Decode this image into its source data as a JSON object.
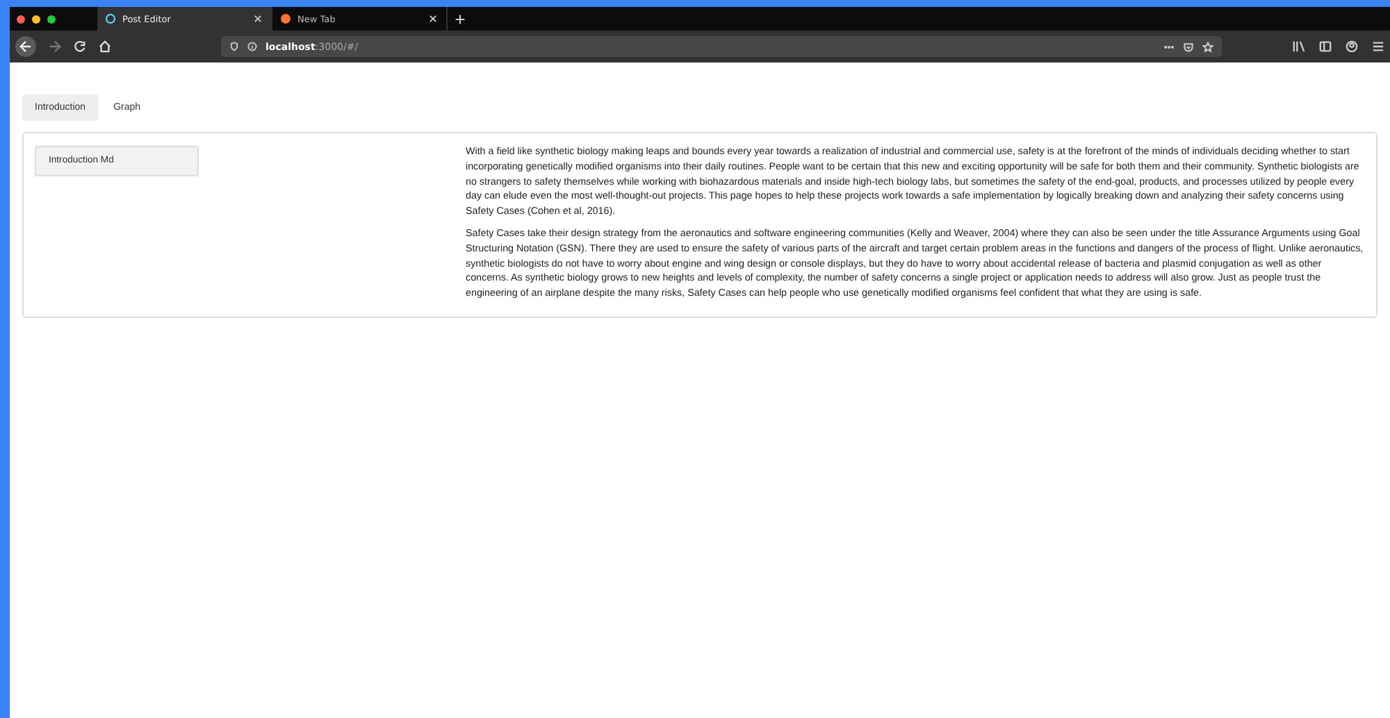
{
  "browser": {
    "tabs": [
      {
        "title": "Post Editor",
        "selected": true
      },
      {
        "title": "New Tab",
        "selected": false
      }
    ],
    "url_host": "localhost",
    "url_rest": ":3000/#/"
  },
  "page_tabs": [
    {
      "label": "Introduction",
      "selected": true
    },
    {
      "label": "Graph",
      "selected": false
    }
  ],
  "sidebar": {
    "items": [
      {
        "label": "Introduction Md",
        "selected": true
      }
    ]
  },
  "paragraphs": [
    "With a field like synthetic biology making leaps and bounds every year towards a realization of industrial and commercial use, safety is at the forefront of the minds of individuals deciding whether to start incorporating genetically modified organisms into their daily routines. People want to be certain that this new and exciting opportunity will be safe for both them and their community. Synthetic biologists are no strangers to safety themselves while working with biohazardous materials and inside high-tech biology labs, but sometimes the safety of the end-goal, products, and processes utilized by people every day can elude even the most well-thought-out projects. This page hopes to help these projects work towards a safe implementation by logically breaking down and analyzing their safety concerns using Safety Cases (Cohen et al, 2016).",
    "Safety Cases take their design strategy from the aeronautics and software engineering communities (Kelly and Weaver, 2004) where they can also be seen under the title Assurance Arguments using Goal Structuring Notation (GSN). There they are used to ensure the safety of various parts of the aircraft and target certain problem areas in the functions and dangers of the process of flight. Unlike aeronautics, synthetic biologists do not have to worry about engine and wing design or console displays, but they do have to worry about accidental release of bacteria and plasmid conjugation as well as other concerns. As synthetic biology grows to new heights and levels of complexity, the number of safety concerns a single project or application needs to address will also grow. Just as people trust the engineering of an airplane despite the many risks, Safety Cases can help people who use genetically modified organisms feel confident that what they are using is safe."
  ]
}
